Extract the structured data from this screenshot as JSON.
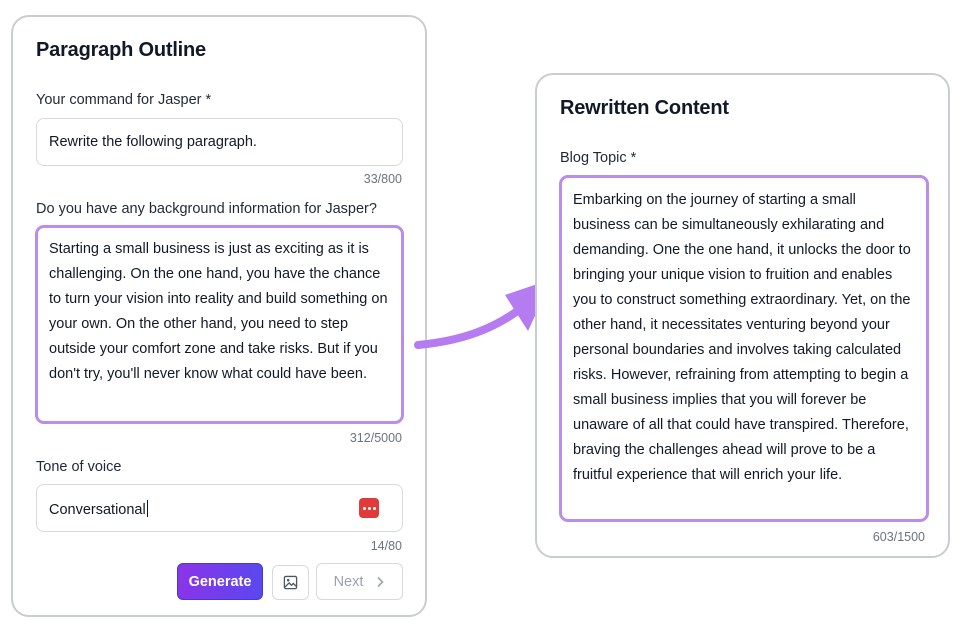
{
  "left_card": {
    "title": "Paragraph Outline",
    "command_label": "Your command for Jasper *",
    "command_value": "Rewrite the following paragraph.",
    "command_counter": "33/800",
    "background_label": "Do you have any background information for Jasper?",
    "background_value": "Starting a small business is just as exciting as it is challenging. On the one hand, you have the chance to turn your vision into reality and build something on your own. On the other hand, you need to step outside your comfort zone and take risks. But if you don't try, you'll never know what could have been.",
    "background_counter": "312/5000",
    "tone_label": "Tone of voice",
    "tone_value": "Conversational",
    "tone_counter": "14/80",
    "generate_label": "Generate",
    "next_label": "Next",
    "icons": {
      "tone_action": "dots-menu-icon",
      "image": "image-icon",
      "next": "chevron-right-icon"
    }
  },
  "right_card": {
    "title": "Rewritten Content",
    "topic_label": "Blog Topic *",
    "topic_value": "Embarking on the journey of starting a small business can be simultaneously exhilarating and demanding. One the one hand, it unlocks the door to bringing your unique vision to fruition and enables you to construct something extraordinary. Yet, on the other hand, it necessitates venturing beyond your personal boundaries and involves taking calculated risks. However, refraining from attempting to begin a small business implies that you will forever be unaware of all that could have transpired. Therefore, braving the challenges ahead will prove to be a fruitful experience that will enrich your life.",
    "topic_counter": "603/1500"
  },
  "colors": {
    "accent_purple": "#b98de8",
    "arrow_purple": "#b57bf0",
    "generate_start": "#8b34e8",
    "generate_end": "#5a48ef",
    "dots_red": "#e03a3a"
  }
}
